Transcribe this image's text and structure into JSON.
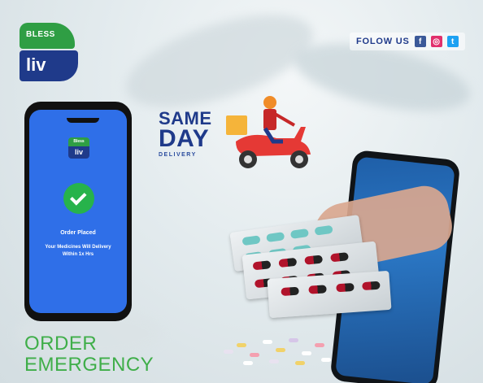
{
  "logo": {
    "top_text": "BLESS",
    "bottom_text": "liv"
  },
  "social": {
    "label": "FOLOW US",
    "icons": [
      "facebook-icon",
      "instagram-icon",
      "twitter-icon"
    ],
    "fb_glyph": "f",
    "ig_glyph": "◎",
    "tw_glyph": "t"
  },
  "phone": {
    "logo_top": "Bless",
    "logo_bottom": "liv",
    "status": "Order Placed",
    "message": "Your Medicines Will Delivery Within 1x Hrs"
  },
  "delivery": {
    "line1": "SAME",
    "line2": "DAY",
    "line3": "DELIVERY"
  },
  "headline": {
    "line1": "ORDER",
    "line2": "EMERGENCY"
  },
  "colors": {
    "brand_green": "#2f9e44",
    "brand_navy": "#1f3a8a",
    "phone_blue": "#2f6fe8",
    "headline_green": "#3fae49"
  }
}
